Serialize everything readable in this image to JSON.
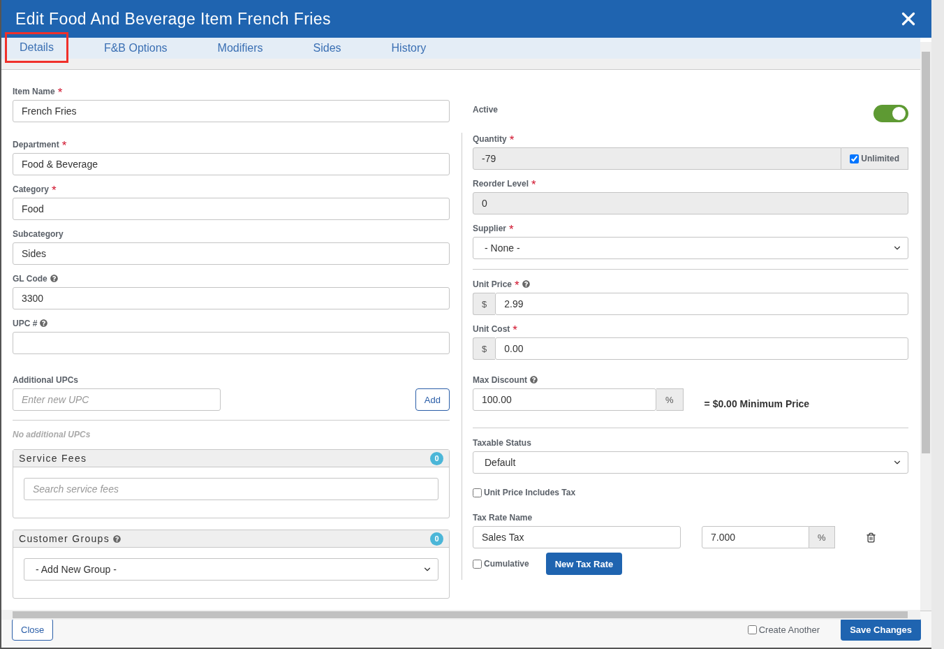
{
  "window": {
    "title": "Edit Food And Beverage Item French Fries"
  },
  "required_mark": "*",
  "tabs": [
    {
      "label": "Details",
      "selected": true
    },
    {
      "label": "F&B Options",
      "selected": false
    },
    {
      "label": "Modifiers",
      "selected": false
    },
    {
      "label": "Sides",
      "selected": false
    },
    {
      "label": "History",
      "selected": false
    }
  ],
  "left_fields": [
    {
      "label": "Item Name",
      "required": true,
      "help": false,
      "value": "French Fries"
    },
    {
      "label": "Department",
      "required": true,
      "help": false,
      "value": "Food & Beverage"
    },
    {
      "label": "Category",
      "required": true,
      "help": false,
      "value": "Food"
    },
    {
      "label": "Subcategory",
      "required": false,
      "help": false,
      "value": "Sides"
    },
    {
      "label": "GL Code",
      "required": false,
      "help": true,
      "value": "3300"
    },
    {
      "label": "UPC #",
      "required": false,
      "help": true
    }
  ],
  "additional_upcs": {
    "label": "Additional UPCs",
    "placeholder": "Enter new UPC",
    "button": "Add",
    "empty_text": "No additional UPCs"
  },
  "service_fees": {
    "title": "Service Fees",
    "count": "0",
    "placeholder": "Search service fees"
  },
  "customer_groups": {
    "title": "Customer Groups",
    "count": "0",
    "value": "- Add New Group -"
  },
  "active": {
    "label": "Active",
    "on": true
  },
  "quantity": {
    "label": "Quantity",
    "required": true,
    "value": "-79",
    "disabled": true,
    "unlimited": {
      "label": "Unlimited",
      "checked": true
    }
  },
  "reorder_level": {
    "label": "Reorder Level",
    "required": true,
    "value": "0",
    "disabled": true
  },
  "supplier": {
    "label": "Supplier",
    "required": true,
    "value": "- None -"
  },
  "unit_price": {
    "label": "Unit Price",
    "required": true,
    "help": true,
    "prefix": "$",
    "value": "2.99"
  },
  "unit_cost": {
    "label": "Unit Cost",
    "required": true,
    "help": false,
    "prefix": "$",
    "value": "0.00"
  },
  "max_discount": {
    "label": "Max Discount",
    "value": "100.00",
    "suffix": "%",
    "result": "= $0.00 Minimum Price"
  },
  "taxable_status": {
    "label": "Taxable Status",
    "value": "Default"
  },
  "unit_price_includes_tax": {
    "label": "Unit Price Includes Tax",
    "checked": false
  },
  "tax_rate": {
    "label": "Tax Rate Name",
    "name": "Sales Tax",
    "rate": "7.000",
    "suffix": "%"
  },
  "cumulative": {
    "label": "Cumulative",
    "checked": false
  },
  "new_tax_rate_button": "New Tax Rate",
  "footer": {
    "close_button": "Close",
    "create_another": {
      "label": "Create Another",
      "checked": false
    },
    "save_button": "Save Changes"
  }
}
